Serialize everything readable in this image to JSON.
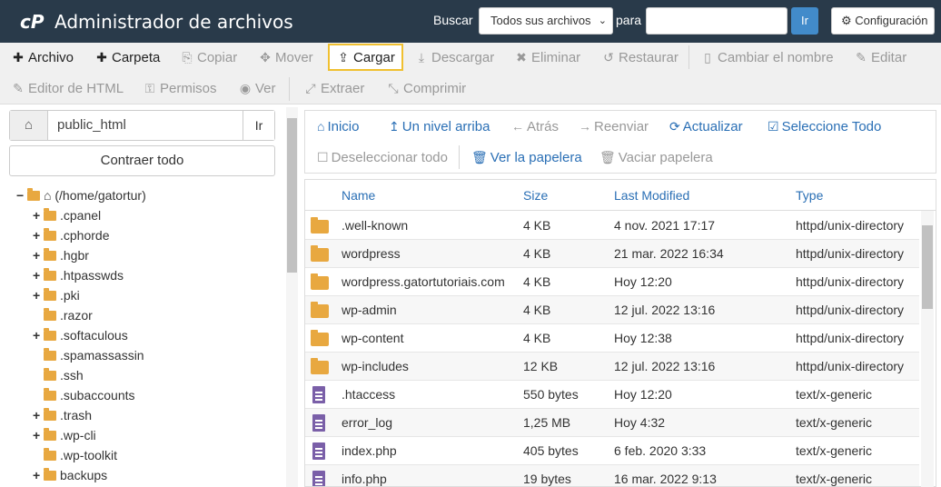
{
  "header": {
    "logo": "cP",
    "title": "Administrador de archivos",
    "search_label": "Buscar",
    "search_scope": "Todos sus archivos",
    "for_label": "para",
    "search_value": "",
    "go_label": "Ir",
    "settings_label": "Configuración"
  },
  "toolbar": {
    "row1": [
      {
        "label": "Archivo",
        "icon": "plus-icon",
        "glyph": "✚"
      },
      {
        "label": "Carpeta",
        "icon": "plus-icon",
        "glyph": "✚"
      },
      {
        "label": "Copiar",
        "icon": "copy-icon",
        "glyph": "⎘"
      },
      {
        "label": "Mover",
        "icon": "move-icon",
        "glyph": "✥"
      },
      {
        "label": "Cargar",
        "icon": "upload-icon",
        "glyph": "⇪"
      },
      {
        "label": "Descargar",
        "icon": "download-icon",
        "glyph": "⤓"
      },
      {
        "label": "Eliminar",
        "icon": "delete-icon",
        "glyph": "✖"
      },
      {
        "label": "Restaurar",
        "icon": "undo-icon",
        "glyph": "↺"
      },
      {
        "label": "Cambiar el nombre",
        "icon": "rename-icon",
        "glyph": "▯"
      },
      {
        "label": "Editar",
        "icon": "pencil-icon",
        "glyph": "✎"
      }
    ],
    "row2": [
      {
        "label": "Editor de HTML",
        "icon": "html-editor-icon",
        "glyph": "✎"
      },
      {
        "label": "Permisos",
        "icon": "key-icon",
        "glyph": "⚿"
      },
      {
        "label": "Ver",
        "icon": "eye-icon",
        "glyph": "◉"
      },
      {
        "label": "Extraer",
        "icon": "expand-icon",
        "glyph": "⤢"
      },
      {
        "label": "Comprimir",
        "icon": "compress-icon",
        "glyph": "⤡"
      }
    ]
  },
  "left": {
    "path": "public_html",
    "go_label": "Ir",
    "collapse_label": "Contraer todo",
    "tree": [
      {
        "label": "(/home/gatortur)",
        "exp": "−",
        "root": true
      },
      {
        "label": ".cpanel",
        "exp": "+"
      },
      {
        "label": ".cphorde",
        "exp": "+"
      },
      {
        "label": ".hgbr",
        "exp": "+"
      },
      {
        "label": ".htpasswds",
        "exp": "+"
      },
      {
        "label": ".pki",
        "exp": "+"
      },
      {
        "label": ".razor",
        "exp": ""
      },
      {
        "label": ".softaculous",
        "exp": "+"
      },
      {
        "label": ".spamassassin",
        "exp": ""
      },
      {
        "label": ".ssh",
        "exp": ""
      },
      {
        "label": ".subaccounts",
        "exp": ""
      },
      {
        "label": ".trash",
        "exp": "+"
      },
      {
        "label": ".wp-cli",
        "exp": "+"
      },
      {
        "label": ".wp-toolkit",
        "exp": ""
      },
      {
        "label": "backups",
        "exp": "+"
      }
    ]
  },
  "actions": {
    "home": "Inicio",
    "up": "Un nivel arriba",
    "back": "Atrás",
    "forward": "Reenviar",
    "refresh": "Actualizar",
    "select_all": "Seleccione Todo",
    "deselect_all": "Deseleccionar todo",
    "view_trash": "Ver la papelera",
    "empty_trash": "Vaciar papelera"
  },
  "table": {
    "columns": [
      "Name",
      "Size",
      "Last Modified",
      "Type"
    ],
    "rows": [
      {
        "kind": "folder",
        "name": ".well-known",
        "size": "4 KB",
        "modified": "4 nov. 2021 17:17",
        "type": "httpd/unix-directory"
      },
      {
        "kind": "folder",
        "name": "wordpress",
        "size": "4 KB",
        "modified": "21 mar. 2022 16:34",
        "type": "httpd/unix-directory"
      },
      {
        "kind": "folder",
        "name": "wordpress.gatortutoriais.com",
        "size": "4 KB",
        "modified": "Hoy 12:20",
        "type": "httpd/unix-directory"
      },
      {
        "kind": "folder",
        "name": "wp-admin",
        "size": "4 KB",
        "modified": "12 jul. 2022 13:16",
        "type": "httpd/unix-directory"
      },
      {
        "kind": "folder",
        "name": "wp-content",
        "size": "4 KB",
        "modified": "Hoy 12:38",
        "type": "httpd/unix-directory"
      },
      {
        "kind": "folder",
        "name": "wp-includes",
        "size": "12 KB",
        "modified": "12 jul. 2022 13:16",
        "type": "httpd/unix-directory"
      },
      {
        "kind": "file",
        "name": ".htaccess",
        "size": "550 bytes",
        "modified": "Hoy 12:20",
        "type": "text/x-generic"
      },
      {
        "kind": "file",
        "name": "error_log",
        "size": "1,25 MB",
        "modified": "Hoy 4:32",
        "type": "text/x-generic"
      },
      {
        "kind": "file",
        "name": "index.php",
        "size": "405 bytes",
        "modified": "6 feb. 2020 3:33",
        "type": "text/x-generic"
      },
      {
        "kind": "file",
        "name": "info.php",
        "size": "19 bytes",
        "modified": "16 mar. 2022 9:13",
        "type": "text/x-generic"
      }
    ]
  }
}
